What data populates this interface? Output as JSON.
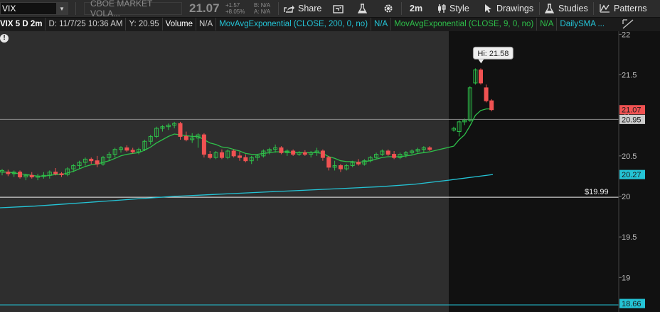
{
  "toolbar": {
    "symbol": "VIX",
    "description": "CBOE MARKET VOLA...",
    "last_price": "21.07",
    "change": "+1.57",
    "change_pct": "+8.05%",
    "bid": "B: N/A",
    "ask": "A: N/A",
    "share_label": "Share",
    "timeframe": "2m",
    "style_label": "Style",
    "drawings_label": "Drawings",
    "studies_label": "Studies",
    "patterns_label": "Patterns"
  },
  "info_bar": {
    "chart_label": "VIX 5 D 2m",
    "date": "D: 11/7/25 10:36 AM",
    "y_value": "Y: 20.95",
    "volume_label": "Volume",
    "volume_value": "N/A",
    "ema200_label": "MovAvgExponential (CLOSE, 200, 0, no)",
    "ema200_value": "N/A",
    "ema9_label": "MovAvgExponential (CLOSE, 9, 0, no)",
    "ema9_value": "N/A",
    "daily_sma_label": "DailySMA ..."
  },
  "price_axis": {
    "ticks": [
      "22",
      "21.5",
      "21",
      "20.5",
      "20",
      "19.5",
      "19"
    ],
    "last_price_tag": "21.07",
    "crosshair_tag": "20.95",
    "ema200_tag": "20.27",
    "bottom_tag": "18.66",
    "range": [
      18.62,
      22.0
    ]
  },
  "annotations": {
    "high_label": "Hi: 21.58",
    "level_label": "$19.99"
  },
  "colors": {
    "up": "#2ec04a",
    "down": "#f05252",
    "ema200": "#24c4d6",
    "ema9": "#2ec04a",
    "background": "#1b1b1b",
    "session_background": "#111111"
  },
  "chart_data": {
    "type": "candlestick",
    "candles": [
      {
        "o": 20.3,
        "h": 20.34,
        "l": 20.26,
        "c": 20.32
      },
      {
        "o": 20.3,
        "h": 20.33,
        "l": 20.25,
        "c": 20.28
      },
      {
        "o": 20.28,
        "h": 20.32,
        "l": 20.24,
        "c": 20.3
      },
      {
        "o": 20.3,
        "h": 20.32,
        "l": 20.22,
        "c": 20.24
      },
      {
        "o": 20.24,
        "h": 20.28,
        "l": 20.2,
        "c": 20.26
      },
      {
        "o": 20.26,
        "h": 20.3,
        "l": 20.22,
        "c": 20.24
      },
      {
        "o": 20.24,
        "h": 20.28,
        "l": 20.2,
        "c": 20.25
      },
      {
        "o": 20.25,
        "h": 20.3,
        "l": 20.22,
        "c": 20.26
      },
      {
        "o": 20.26,
        "h": 20.32,
        "l": 20.22,
        "c": 20.3
      },
      {
        "o": 20.3,
        "h": 20.35,
        "l": 20.26,
        "c": 20.28
      },
      {
        "o": 20.28,
        "h": 20.3,
        "l": 20.24,
        "c": 20.27
      },
      {
        "o": 20.27,
        "h": 20.36,
        "l": 20.25,
        "c": 20.34
      },
      {
        "o": 20.34,
        "h": 20.4,
        "l": 20.3,
        "c": 20.38
      },
      {
        "o": 20.38,
        "h": 20.44,
        "l": 20.34,
        "c": 20.42
      },
      {
        "o": 20.42,
        "h": 20.48,
        "l": 20.38,
        "c": 20.46
      },
      {
        "o": 20.46,
        "h": 20.48,
        "l": 20.4,
        "c": 20.44
      },
      {
        "o": 20.44,
        "h": 20.5,
        "l": 20.36,
        "c": 20.4
      },
      {
        "o": 20.4,
        "h": 20.5,
        "l": 20.38,
        "c": 20.48
      },
      {
        "o": 20.48,
        "h": 20.55,
        "l": 20.44,
        "c": 20.52
      },
      {
        "o": 20.52,
        "h": 20.6,
        "l": 20.48,
        "c": 20.58
      },
      {
        "o": 20.58,
        "h": 20.62,
        "l": 20.54,
        "c": 20.6
      },
      {
        "o": 20.6,
        "h": 20.63,
        "l": 20.55,
        "c": 20.57
      },
      {
        "o": 20.57,
        "h": 20.6,
        "l": 20.53,
        "c": 20.55
      },
      {
        "o": 20.55,
        "h": 20.6,
        "l": 20.52,
        "c": 20.58
      },
      {
        "o": 20.58,
        "h": 20.7,
        "l": 20.56,
        "c": 20.68
      },
      {
        "o": 20.68,
        "h": 20.76,
        "l": 20.64,
        "c": 20.74
      },
      {
        "o": 20.74,
        "h": 20.86,
        "l": 20.72,
        "c": 20.84
      },
      {
        "o": 20.84,
        "h": 20.88,
        "l": 20.8,
        "c": 20.86
      },
      {
        "o": 20.86,
        "h": 20.9,
        "l": 20.82,
        "c": 20.88
      },
      {
        "o": 20.88,
        "h": 20.92,
        "l": 20.84,
        "c": 20.9
      },
      {
        "o": 20.9,
        "h": 20.92,
        "l": 20.7,
        "c": 20.74
      },
      {
        "o": 20.74,
        "h": 20.8,
        "l": 20.68,
        "c": 20.7
      },
      {
        "o": 20.7,
        "h": 20.78,
        "l": 20.66,
        "c": 20.72
      },
      {
        "o": 20.72,
        "h": 20.78,
        "l": 20.6,
        "c": 20.76
      },
      {
        "o": 20.76,
        "h": 20.78,
        "l": 20.48,
        "c": 20.52
      },
      {
        "o": 20.52,
        "h": 20.56,
        "l": 20.46,
        "c": 20.48
      },
      {
        "o": 20.48,
        "h": 20.56,
        "l": 20.46,
        "c": 20.54
      },
      {
        "o": 20.54,
        "h": 20.58,
        "l": 20.46,
        "c": 20.48
      },
      {
        "o": 20.48,
        "h": 20.58,
        "l": 20.46,
        "c": 20.56
      },
      {
        "o": 20.56,
        "h": 20.58,
        "l": 20.48,
        "c": 20.5
      },
      {
        "o": 20.5,
        "h": 20.55,
        "l": 20.44,
        "c": 20.48
      },
      {
        "o": 20.48,
        "h": 20.52,
        "l": 20.42,
        "c": 20.44
      },
      {
        "o": 20.44,
        "h": 20.5,
        "l": 20.4,
        "c": 20.48
      },
      {
        "o": 20.48,
        "h": 20.52,
        "l": 20.44,
        "c": 20.5
      },
      {
        "o": 20.5,
        "h": 20.58,
        "l": 20.48,
        "c": 20.56
      },
      {
        "o": 20.56,
        "h": 20.6,
        "l": 20.52,
        "c": 20.58
      },
      {
        "o": 20.58,
        "h": 20.64,
        "l": 20.54,
        "c": 20.6
      },
      {
        "o": 20.6,
        "h": 20.62,
        "l": 20.52,
        "c": 20.54
      },
      {
        "o": 20.54,
        "h": 20.58,
        "l": 20.5,
        "c": 20.56
      },
      {
        "o": 20.56,
        "h": 20.58,
        "l": 20.5,
        "c": 20.52
      },
      {
        "o": 20.52,
        "h": 20.56,
        "l": 20.5,
        "c": 20.54
      },
      {
        "o": 20.54,
        "h": 20.57,
        "l": 20.5,
        "c": 20.52
      },
      {
        "o": 20.52,
        "h": 20.56,
        "l": 20.48,
        "c": 20.54
      },
      {
        "o": 20.54,
        "h": 20.6,
        "l": 20.5,
        "c": 20.56
      },
      {
        "o": 20.56,
        "h": 20.58,
        "l": 20.44,
        "c": 20.48
      },
      {
        "o": 20.48,
        "h": 20.5,
        "l": 20.32,
        "c": 20.36
      },
      {
        "o": 20.36,
        "h": 20.44,
        "l": 20.32,
        "c": 20.38
      },
      {
        "o": 20.38,
        "h": 20.4,
        "l": 20.3,
        "c": 20.34
      },
      {
        "o": 20.34,
        "h": 20.4,
        "l": 20.32,
        "c": 20.38
      },
      {
        "o": 20.38,
        "h": 20.44,
        "l": 20.36,
        "c": 20.42
      },
      {
        "o": 20.42,
        "h": 20.46,
        "l": 20.38,
        "c": 20.4
      },
      {
        "o": 20.4,
        "h": 20.46,
        "l": 20.38,
        "c": 20.44
      },
      {
        "o": 20.44,
        "h": 20.5,
        "l": 20.42,
        "c": 20.48
      },
      {
        "o": 20.48,
        "h": 20.54,
        "l": 20.46,
        "c": 20.52
      },
      {
        "o": 20.52,
        "h": 20.58,
        "l": 20.5,
        "c": 20.56
      },
      {
        "o": 20.56,
        "h": 20.58,
        "l": 20.5,
        "c": 20.52
      },
      {
        "o": 20.52,
        "h": 20.56,
        "l": 20.46,
        "c": 20.48
      },
      {
        "o": 20.48,
        "h": 20.54,
        "l": 20.46,
        "c": 20.52
      },
      {
        "o": 20.52,
        "h": 20.56,
        "l": 20.48,
        "c": 20.54
      },
      {
        "o": 20.54,
        "h": 20.58,
        "l": 20.52,
        "c": 20.56
      },
      {
        "o": 20.56,
        "h": 20.6,
        "l": 20.54,
        "c": 20.58
      },
      {
        "o": 20.58,
        "h": 20.62,
        "l": 20.54,
        "c": 20.6
      },
      {
        "o": 20.6,
        "h": 20.62,
        "l": 20.56,
        "c": 20.58
      },
      {
        "o": 20.82,
        "h": 20.86,
        "l": 20.8,
        "c": 20.84
      },
      {
        "o": 20.8,
        "h": 20.94,
        "l": 20.74,
        "c": 20.92
      },
      {
        "o": 20.92,
        "h": 20.96,
        "l": 20.88,
        "c": 20.94
      },
      {
        "o": 20.94,
        "h": 21.36,
        "l": 20.92,
        "c": 21.34
      },
      {
        "o": 21.4,
        "h": 21.58,
        "l": 21.38,
        "c": 21.56
      },
      {
        "o": 21.56,
        "h": 21.58,
        "l": 21.38,
        "c": 21.4
      },
      {
        "o": 21.34,
        "h": 21.38,
        "l": 21.16,
        "c": 21.18
      },
      {
        "o": 21.18,
        "h": 21.2,
        "l": 21.05,
        "c": 21.07
      }
    ],
    "ema9": [
      20.3,
      20.3,
      20.29,
      20.28,
      20.27,
      20.26,
      20.25,
      20.25,
      20.26,
      20.27,
      20.27,
      20.29,
      20.31,
      20.34,
      20.37,
      20.39,
      20.4,
      20.42,
      20.44,
      20.47,
      20.5,
      20.52,
      20.53,
      20.54,
      20.57,
      20.61,
      20.66,
      20.7,
      20.74,
      20.77,
      20.76,
      20.75,
      20.74,
      20.74,
      20.7,
      20.66,
      20.64,
      20.61,
      20.6,
      20.58,
      20.56,
      20.53,
      20.52,
      20.52,
      20.53,
      20.54,
      20.55,
      20.55,
      20.55,
      20.54,
      20.54,
      20.54,
      20.54,
      20.54,
      20.53,
      20.49,
      20.47,
      20.44,
      20.43,
      20.43,
      20.42,
      20.43,
      20.44,
      20.46,
      20.48,
      20.49,
      20.49,
      20.49,
      20.5,
      20.51,
      20.53,
      20.54,
      20.55,
      20.62,
      20.7,
      20.76,
      20.87,
      21.0,
      21.06,
      21.08,
      21.08
    ],
    "ema200": [
      19.86,
      19.88,
      19.91,
      19.94,
      19.97,
      20.0,
      20.02,
      20.04,
      20.06,
      20.08,
      20.1,
      20.12,
      20.15,
      20.2,
      20.27
    ],
    "hline": 19.99,
    "crosshair_y": 20.95,
    "ylim": [
      18.62,
      22.0
    ]
  }
}
